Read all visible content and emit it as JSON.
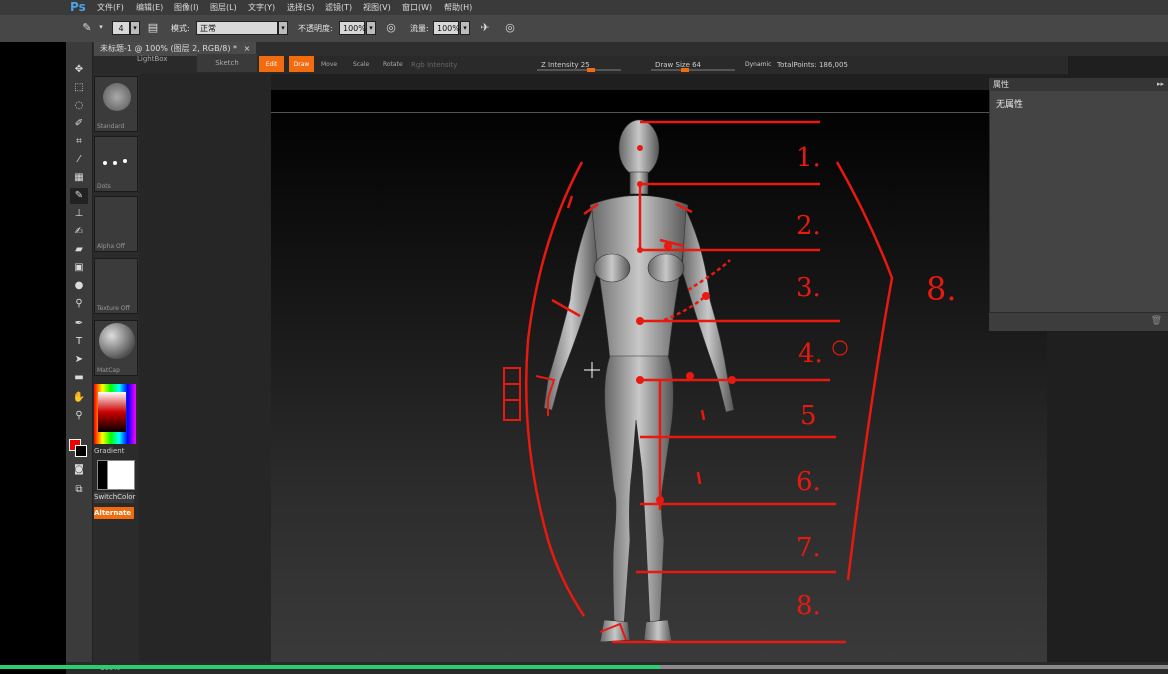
{
  "app": {
    "logo": "Ps"
  },
  "menu": [
    "文件(F)",
    "编辑(E)",
    "图像(I)",
    "图层(L)",
    "文字(Y)",
    "选择(S)",
    "滤镜(T)",
    "视图(V)",
    "窗口(W)",
    "帮助(H)"
  ],
  "options": {
    "brush_size": "4",
    "mode_label": "模式:",
    "mode_value": "正常",
    "opacity_label": "不透明度:",
    "opacity_value": "100%",
    "flow_label": "流量:",
    "flow_value": "100%"
  },
  "doc_tab": {
    "label": "未标题-1 @ 100% (图层 2, RGB/8) *",
    "close": "×"
  },
  "zbrush": {
    "top": {
      "lightbox": "LightBox",
      "sketch": "Sketch",
      "edit": "Edit",
      "draw": "Draw",
      "move": "Move",
      "scale": "Scale",
      "rotate": "Rotate",
      "rgb_intensity": "Rgb Intensity",
      "z_intensity": "Z Intensity 25",
      "draw_size": "Draw Size 64",
      "dynamic": "Dynamic",
      "total_points": "TotalPoints: 186,005"
    },
    "side": {
      "brush_label": "Standard",
      "stroke_label": "Dots",
      "alpha_label": "Alpha Off",
      "texture_label": "Texture Off",
      "material_label": "MatCap",
      "gradient_label": "Gradient",
      "switch_color": "SwitchColor",
      "alternate": "Alternate"
    }
  },
  "annotations": {
    "heads": [
      "1.",
      "2.",
      "3.",
      "4.",
      "5",
      "6.",
      "7.",
      "8."
    ],
    "total": "8."
  },
  "properties": {
    "title": "属性",
    "body": "无属性"
  },
  "status": {
    "zoom": "100%"
  },
  "colors": {
    "annotation": "#e8190f",
    "orange_button": "#f26b0f",
    "progress": "#2ecc71",
    "ps_blue": "#4aa3e8"
  },
  "icons": [
    "move-tool-icon",
    "marquee-tool-icon",
    "lasso-tool-icon",
    "quick-select-tool-icon",
    "crop-tool-icon",
    "eyedropper-tool-icon",
    "healing-brush-icon",
    "brush-tool-icon",
    "stamp-tool-icon",
    "history-brush-icon",
    "eraser-tool-icon",
    "gradient-tool-icon",
    "blur-tool-icon",
    "dodge-tool-icon",
    "pen-tool-icon",
    "type-tool-icon",
    "path-select-icon",
    "rectangle-tool-icon",
    "hand-tool-icon",
    "zoom-tool-icon"
  ]
}
